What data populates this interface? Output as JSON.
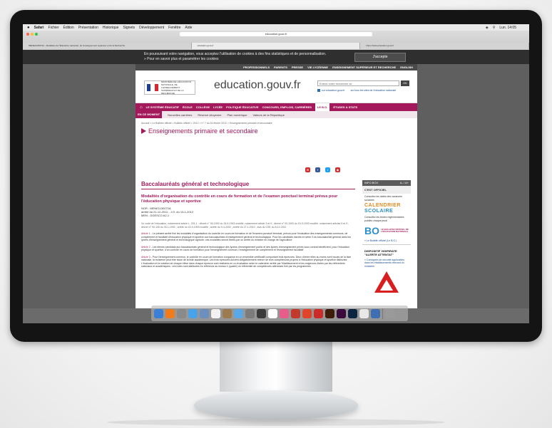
{
  "menubar": {
    "apple": "",
    "items": [
      "Safari",
      "Fichier",
      "Édition",
      "Présentation",
      "Historique",
      "Signets",
      "Développement",
      "Fenêtre",
      "Aide"
    ],
    "clock": "Lun. 14:05"
  },
  "browser": {
    "url": "education.gouv.fr",
    "tabs": [
      "MENE1130072A - Modalités de l'Éducation nationale, de l'enseignement supérieur et de la Recherche",
      "education.gouv.fr",
      "https://www.education.gouv.fr"
    ]
  },
  "cookie": {
    "text_line1": "En poursuivant votre navigation, vous acceptez l'utilisation de cookies à des fins statistiques et de personnalisation.",
    "text_line2": "» Pour en savoir plus et paramétrer les cookies",
    "accept": "J'accepte"
  },
  "topnav": [
    "PROFESSIONNELS",
    "PARENTS",
    "PRESSE",
    "VIE LYCÉENNE",
    "ENSEIGNEMENT SUPÉRIEUR ET RECHERCHE",
    "ENGLISH"
  ],
  "header": {
    "site_title": "education.gouv.fr",
    "search_placeholder": "Entrez votre recherche ici",
    "search_button": "OK",
    "scope1": "sur education.gouv.fr",
    "scope2": "sur tous les sites de l'éducation nationale",
    "ministry": "MINISTÈRE DE L'ÉDUCATION NATIONALE, DE L'ENSEIGNEMENT SUPÉRIEUR ET DE LA RECHERCHE"
  },
  "mainnav": {
    "items": [
      "LE SYSTÈME ÉDUCATIF",
      "ÉCOLE",
      "COLLÈGE",
      "LYCÉE",
      "POLITIQUE ÉDUCATIVE",
      "CONCOURS, EMPLOIS, CARRIÈRES"
    ],
    "active": "LE B.O.",
    "last": "ÉTUDES & STATS"
  },
  "subnav": {
    "label": "EN CE MOMENT",
    "items": [
      "Nouvelles carrières",
      "Réserve citoyenne",
      "Plan numérique",
      "Valeurs de la République"
    ]
  },
  "breadcrumb": "Accueil > Le Bulletin officiel > Bulletin officiel > 2012 > n° 7 du 16 février 2012 > Enseignements primaire et secondaire",
  "section_title": "Enseignements primaire et secondaire",
  "article": {
    "title": "Baccalauréats général et technologique",
    "subtitle": "Modalités d'organisation du contrôle en cours de formation et de l'examen ponctuel terminal prévus pour l'éducation physique et sportive",
    "meta1": "NOR : MENE1130072A",
    "meta2": "arrêté du 21-12-2011 - J.O. du 13-1-2012",
    "meta3": "MEN - DGESCO A2-1",
    "visa": "Vu code de l'éducation, notamment article L. 331-1 ; décret n° 93-1092 du 15-9-1993 modifié, notamment article 3 et 9 ; décret n° 93-1093 du 15-9-1993 modifié, notamment articles 5 et 9 ; décret n° 90-106 du 30-1-1992 ; arrêté du 15-9-1993 modifié ; arrêté du 9-4-2002 ; arrêté du 27-1-2010 ; avis du CSE du 8-12-2011",
    "art1_label": "Article 1",
    "art1": " - Le présent arrêté fixe les modalités d'organisation du contrôle en cours de formation et de l'examen ponctuel terminal, prévus pour l'évaluation des enseignements communs, de complément et facultatif d'éducation physique et sportive aux baccalauréats d'enseignement général et technologique. Pour les candidats inscrits en série S du baccalauréat général dans les lycées d'enseignement général et technologique agricole, ces modalités seront fixées par un arrêté du ministre en charge de l'agriculture.",
    "art2_label": "Article 2",
    "art2": " - Les élèves candidats aux baccalauréats général et technologique des lycées d'enseignement public et des lycées d'enseignement privés sous contrat bénéficient, pour l'éducation physique et sportive, d'un contrôle en cours de formation pour l'enseignement commun, l'enseignement de complément et l'enseignement facultatif.",
    "art3_label": "Article 3",
    "art3": " - Pour l'enseignement commun, le contrôle en cours de formation s'organise en un ensemble certificatif comportant trois épreuves. Deux d'entre elles au moins sont issues de la liste nationale, la troisième peut être issue de la liste académique. Les trois épreuves doivent obligatoirement relever de trois compétences propres à l'éducation physique et sportive distinctes. L'évaluation et la notation de chaque élève dans chaque épreuve sont réalisées en co-évaluation selon le calendrier arrêté par l'établissement et les exigences fixées par les référentiels nationaux et académiques. Les notes sont attribuées en référence au niveau 4 (quatre) du référentiel de compétences attendues fixé par les programmes."
  },
  "sidebar": {
    "head": "INFO BOX",
    "size": "A- / A+",
    "label": "C'EST OFFICIEL",
    "text1": "Consultez les dates des vacances scolaires",
    "cal1": "CALENDRIER",
    "cal2": "SCOLAIRE",
    "text2": "Consultez les textes réglementaires publiés chaque jeudi",
    "bo_big": "BO",
    "bo_small": "LE BULLETIN OFFICIEL DE L'ÉDUCATION NATIONALE",
    "bo_link": "» Le Bulletin officiel (Le B.O.)",
    "vigi_title": "DISPOSITIF VIGIPIRATE \"ALERTE ATTENTAT\"",
    "vigi_link": "» Consignes de sécurité applicables dans les établissements relevant du ministère",
    "vigi_label": "VIGIPIRATE"
  }
}
